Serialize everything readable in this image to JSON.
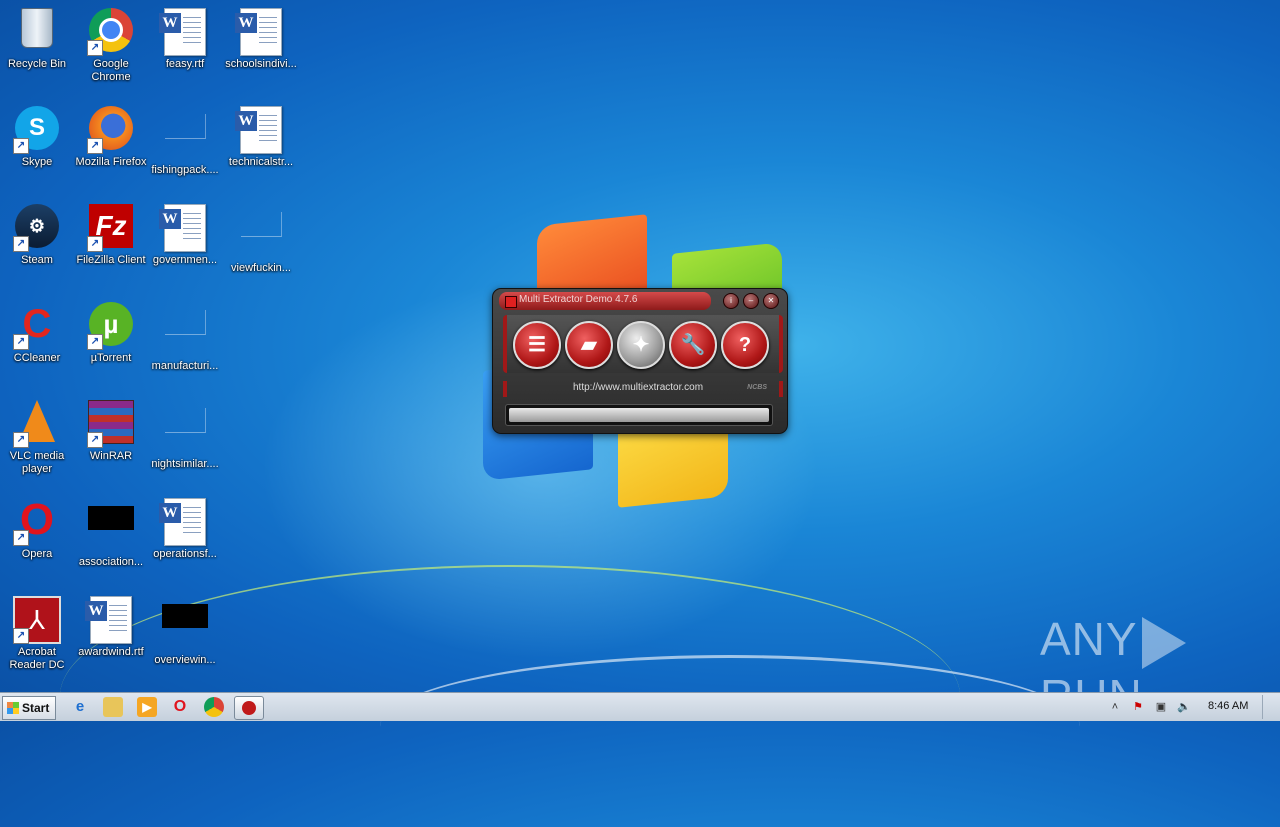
{
  "desktop": {
    "icons": [
      {
        "label": "Recycle Bin"
      },
      {
        "label": "Google Chrome"
      },
      {
        "label": "feasy.rtf"
      },
      {
        "label": "schoolsindivi..."
      },
      {
        "label": "Skype"
      },
      {
        "label": "Mozilla Firefox"
      },
      {
        "label": "fishingpack...."
      },
      {
        "label": "technicalstr..."
      },
      {
        "label": "Steam"
      },
      {
        "label": "FileZilla Client"
      },
      {
        "label": "governmen..."
      },
      {
        "label": "viewfuckin..."
      },
      {
        "label": "CCleaner"
      },
      {
        "label": "µTorrent"
      },
      {
        "label": "manufacturi..."
      },
      {
        "label": "VLC media player"
      },
      {
        "label": "WinRAR"
      },
      {
        "label": "nightsimilar...."
      },
      {
        "label": "Opera"
      },
      {
        "label": "association..."
      },
      {
        "label": "operationsf..."
      },
      {
        "label": "Acrobat Reader DC"
      },
      {
        "label": "awardwind.rtf"
      },
      {
        "label": "overviewin..."
      }
    ]
  },
  "app": {
    "title": "Multi Extractor Demo 4.7.6",
    "url": "http://www.multiextractor.com",
    "brand": "NCBS",
    "progress": 1.0
  },
  "watermark": {
    "left": "ANY",
    "right": "RUN"
  },
  "taskbar": {
    "start_label": "Start",
    "clock": "8:46 AM"
  }
}
